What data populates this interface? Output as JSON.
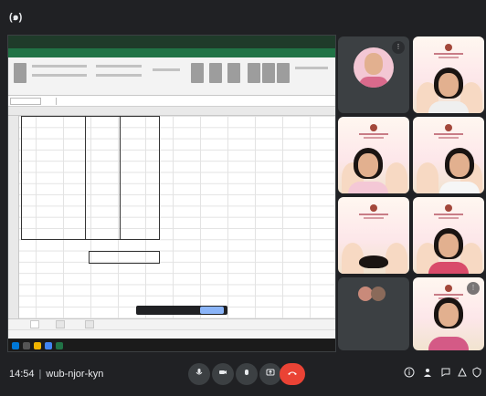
{
  "top_bar": {
    "cc_label": "(๑)",
    "title": ""
  },
  "excel": {
    "rows": [
      {
        "label": "",
        "amount": ""
      },
      {
        "label": "",
        "amount": ""
      },
      {
        "label": "",
        "amount": ""
      },
      {
        "label": "",
        "amount": ""
      },
      {
        "label": "",
        "amount": ""
      },
      {
        "label": "",
        "amount": ""
      },
      {
        "label": "",
        "amount": ""
      },
      {
        "label": "",
        "amount": ""
      },
      {
        "label": "",
        "amount": ""
      },
      {
        "label": "",
        "amount": ""
      },
      {
        "label": "",
        "amount": ""
      },
      {
        "label": "",
        "amount": ""
      }
    ],
    "total_label": "",
    "total_value": "",
    "sheet_tabs": [
      "",
      "",
      ""
    ],
    "share_notice": ""
  },
  "participants": [
    {
      "name": "",
      "muted": true
    },
    {
      "name": ""
    },
    {
      "name": ""
    },
    {
      "name": ""
    },
    {
      "name": ""
    },
    {
      "name": ""
    },
    {
      "name": "",
      "count_label": ""
    },
    {
      "name": ""
    }
  ],
  "bottom_bar": {
    "time": "14:54",
    "meeting_code": "wub-njor-kyn",
    "controls": [
      "mic-icon",
      "camera-icon",
      "raise-hand-icon",
      "present-icon",
      "more-icon",
      "end-call-icon"
    ],
    "side_controls": [
      "info-icon",
      "people-icon",
      "chat-icon",
      "activities-icon",
      "host-controls-icon"
    ]
  }
}
